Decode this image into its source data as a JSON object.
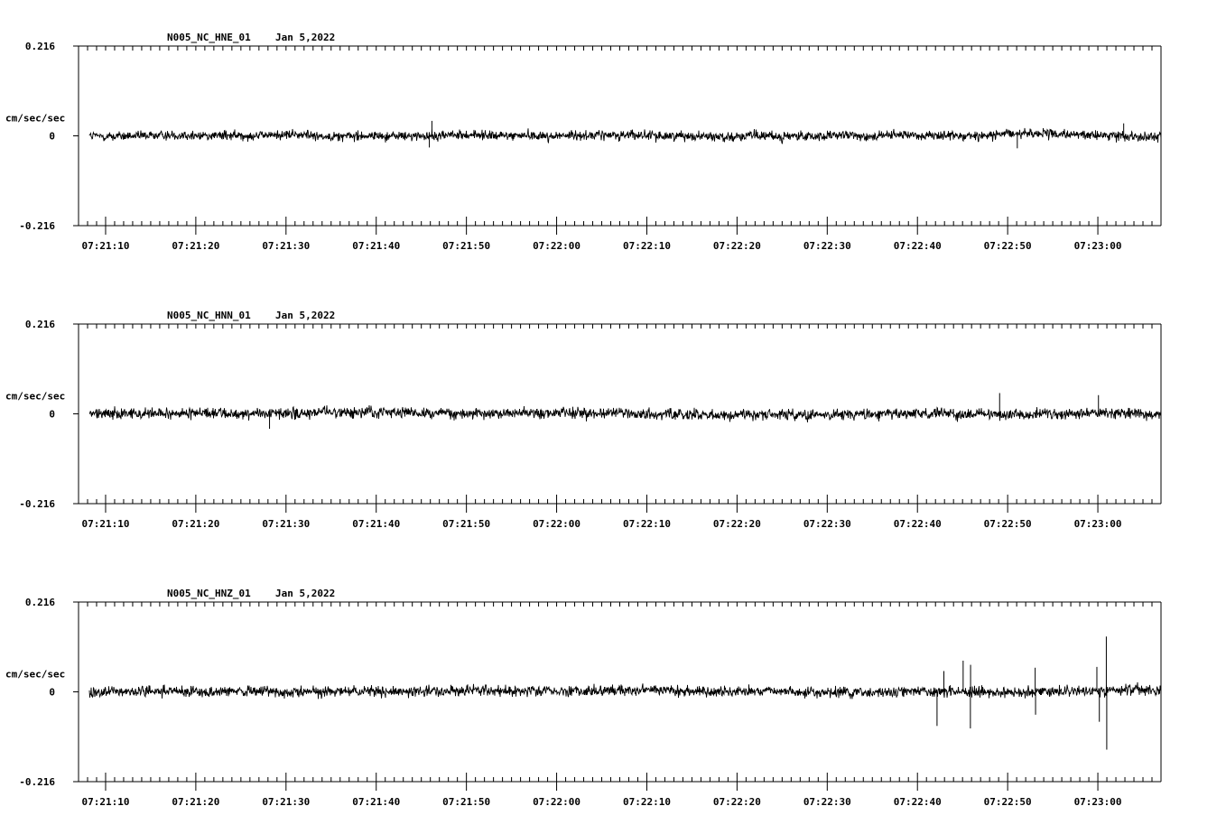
{
  "chart_data": [
    {
      "type": "line",
      "title": "N005_NC_HNE_01",
      "date": "Jan 5,2022",
      "ylabel": "cm/sec/sec",
      "ylim": [
        -0.216,
        0.216
      ],
      "ytick_labels": [
        "0.216",
        "0",
        "-0.216"
      ],
      "x_start": "07:21:07",
      "x_end": "07:23:07",
      "xtick_labels": [
        "07:21:10",
        "07:21:20",
        "07:21:30",
        "07:21:40",
        "07:21:50",
        "07:22:00",
        "07:22:10",
        "07:22:20",
        "07:22:30",
        "07:22:40",
        "07:22:50",
        "07:23:00"
      ],
      "series": [
        {
          "values_summary": "ambient noise trace",
          "noise_amplitude": 0.018,
          "points": [
            {
              "t": "07:21:46",
              "y": 0.036
            },
            {
              "t": "07:21:46",
              "y": -0.028
            },
            {
              "t": "07:22:51",
              "y": -0.03
            },
            {
              "t": "07:23:03",
              "y": 0.03
            }
          ]
        }
      ],
      "grid": false
    },
    {
      "type": "line",
      "title": "N005_NC_HNN_01",
      "date": "Jan 5,2022",
      "ylabel": "cm/sec/sec",
      "ylim": [
        -0.216,
        0.216
      ],
      "ytick_labels": [
        "0.216",
        "0",
        "-0.216"
      ],
      "x_start": "07:21:07",
      "x_end": "07:23:07",
      "xtick_labels": [
        "07:21:10",
        "07:21:20",
        "07:21:30",
        "07:21:40",
        "07:21:50",
        "07:22:00",
        "07:22:10",
        "07:22:20",
        "07:22:30",
        "07:22:40",
        "07:22:50",
        "07:23:00"
      ],
      "series": [
        {
          "values_summary": "ambient noise trace",
          "noise_amplitude": 0.02,
          "points": [
            {
              "t": "07:21:28",
              "y": -0.036
            },
            {
              "t": "07:22:49",
              "y": 0.05
            },
            {
              "t": "07:23:00",
              "y": 0.045
            }
          ]
        }
      ],
      "grid": false
    },
    {
      "type": "line",
      "title": "N005_NC_HNZ_01",
      "date": "Jan 5,2022",
      "ylabel": "cm/sec/sec",
      "ylim": [
        -0.216,
        0.216
      ],
      "ytick_labels": [
        "0.216",
        "0",
        "-0.216"
      ],
      "x_start": "07:21:07",
      "x_end": "07:23:07",
      "xtick_labels": [
        "07:21:10",
        "07:21:20",
        "07:21:30",
        "07:21:40",
        "07:21:50",
        "07:22:00",
        "07:22:10",
        "07:22:20",
        "07:22:30",
        "07:22:40",
        "07:22:50",
        "07:23:00"
      ],
      "series": [
        {
          "values_summary": "ambient noise trace with transient spikes",
          "noise_amplitude": 0.02,
          "points": [
            {
              "t": "07:22:42",
              "y": -0.082
            },
            {
              "t": "07:22:43",
              "y": 0.05
            },
            {
              "t": "07:22:45",
              "y": 0.075
            },
            {
              "t": "07:22:46",
              "y": -0.088
            },
            {
              "t": "07:22:46",
              "y": 0.065
            },
            {
              "t": "07:22:53",
              "y": 0.058
            },
            {
              "t": "07:22:53",
              "y": -0.055
            },
            {
              "t": "07:23:00",
              "y": 0.06
            },
            {
              "t": "07:23:01",
              "y": 0.133
            },
            {
              "t": "07:23:01",
              "y": -0.139
            },
            {
              "t": "07:23:00",
              "y": -0.072
            }
          ]
        }
      ],
      "grid": false
    }
  ]
}
